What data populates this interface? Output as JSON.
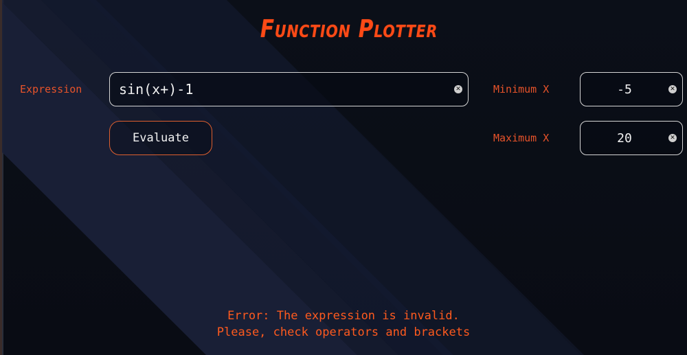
{
  "title": "Function Plotter",
  "expression": {
    "label": "Expression",
    "value": "sin(x+)-1",
    "clear_icon": "close-icon"
  },
  "evaluate_button": {
    "label": "Evaluate"
  },
  "min_x": {
    "label": "Minimum X",
    "value": "-5",
    "clear_icon": "close-icon"
  },
  "max_x": {
    "label": "Maximum X",
    "value": "20",
    "clear_icon": "close-icon"
  },
  "error": {
    "line1": "Error: The expression is invalid.",
    "line2": "Please, check operators and brackets"
  },
  "colors": {
    "accent": "#ff4a16",
    "label": "#e8532a",
    "background": "#090d15",
    "band": "#1a2138",
    "field_border": "#d6d6d6",
    "text": "#f2f2f2"
  }
}
